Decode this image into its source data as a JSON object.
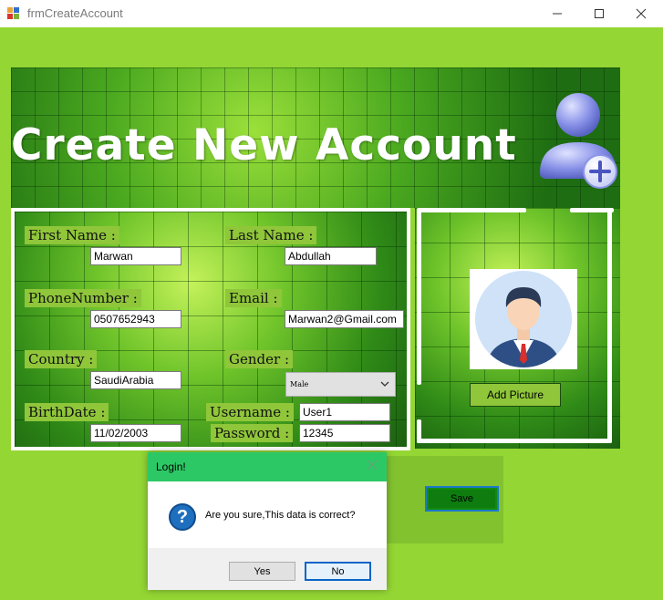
{
  "window": {
    "title": "frmCreateAccount"
  },
  "banner": {
    "title": "Create New Account"
  },
  "form": {
    "first_name": {
      "label": "First Name :",
      "value": "Marwan"
    },
    "last_name": {
      "label": "Last Name :",
      "value": "Abdullah"
    },
    "phone": {
      "label": "PhoneNumber :",
      "value": "0507652943"
    },
    "email": {
      "label": "Email :",
      "value": "Marwan2@Gmail.com"
    },
    "country": {
      "label": "Country :",
      "value": "SaudiArabia"
    },
    "gender": {
      "label": "Gender :",
      "value": "Male"
    },
    "birthdate": {
      "label": "BirthDate :",
      "value": "11/02/2003"
    },
    "username": {
      "label": "Username :",
      "value": "User1"
    },
    "password": {
      "label": "Password :",
      "value": "12345"
    }
  },
  "picture": {
    "add_label": "Add Picture"
  },
  "save": {
    "label": "Save"
  },
  "dialog": {
    "title": "Login!",
    "message": "Are you sure,This data is correct?",
    "yes_label": "Yes",
    "no_label": "No",
    "icon": "question-icon"
  },
  "colors": {
    "background": "#94d634",
    "label_bg": "#8fc63a",
    "dialog_title": "#2dc866",
    "save_button": "#0e7c0e"
  }
}
